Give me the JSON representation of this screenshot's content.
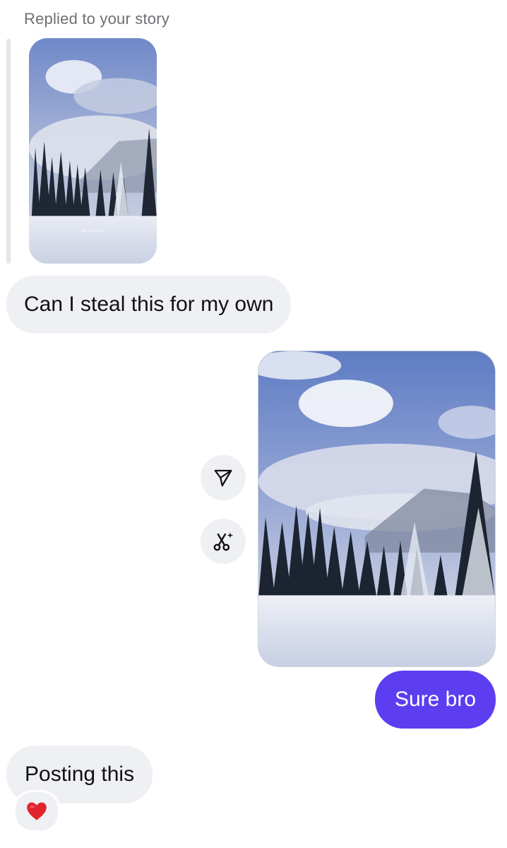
{
  "story_reply": {
    "label": "Replied to your story",
    "thumbnail": "snowy-forest-mountain-photo",
    "caption_text": "@jiyuk_snowtravels"
  },
  "messages": [
    {
      "sender": "them",
      "text": "Can I steal this for my own"
    },
    {
      "sender": "me",
      "type": "photo",
      "image": "snowy-forest-mountain-photo"
    },
    {
      "sender": "me",
      "text": "Sure bro"
    },
    {
      "sender": "them",
      "text": "Posting this",
      "reaction": "red-heart"
    }
  ],
  "actions": {
    "share_icon": "paper-plane-icon",
    "remix_icon": "scissors-sparkle-icon"
  },
  "colors": {
    "incoming_bubble": "#eff0f3",
    "outgoing_bubble": "#5c3df0",
    "reply_label": "#6f6f74",
    "heart": "#e0242e"
  }
}
